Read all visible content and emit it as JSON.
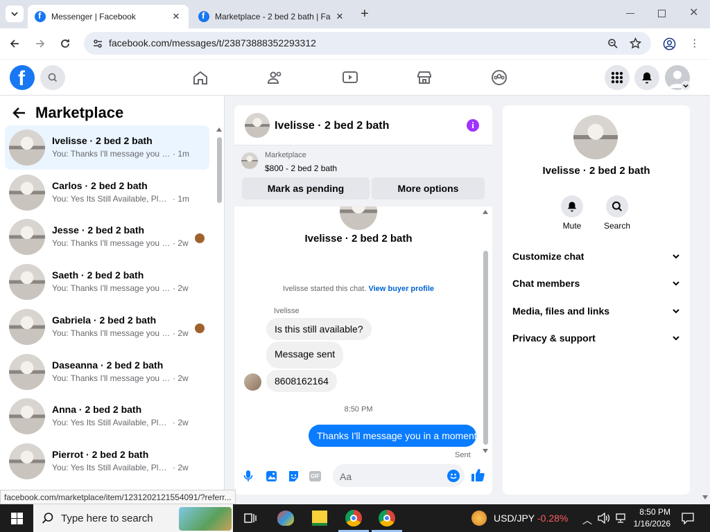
{
  "browser": {
    "tabs": [
      {
        "title": "Messenger | Facebook",
        "active": true
      },
      {
        "title": "Marketplace - 2 bed 2 bath | Fa",
        "active": false
      }
    ],
    "url": "facebook.com/messages/t/23873888352293312",
    "status_url": "facebook.com/marketplace/item/1231202121554091/?referr..."
  },
  "sidebar": {
    "title": "Marketplace",
    "conversations": [
      {
        "name": "Ivelisse · 2 bed 2 bath",
        "preview": "You: Thanks I'll message you in a ...",
        "time": "· 1m",
        "selected": true,
        "seen": false
      },
      {
        "name": "Carlos · 2 bed 2 bath",
        "preview": "You: Yes Its Still Available, Please S...",
        "time": "· 1m",
        "selected": false,
        "seen": false
      },
      {
        "name": "Jesse · 2 bed 2 bath",
        "preview": "You: Thanks I'll message you in ...",
        "time": "· 2w",
        "selected": false,
        "seen": true
      },
      {
        "name": "Saeth · 2 bed 2 bath",
        "preview": "You: Thanks I'll message you in a ...",
        "time": "· 2w",
        "selected": false,
        "seen": false
      },
      {
        "name": "Gabriela · 2 bed 2 bath",
        "preview": "You: Thanks I'll message you in ...",
        "time": "· 2w",
        "selected": false,
        "seen": true
      },
      {
        "name": "Daseanna · 2 bed 2 bath",
        "preview": "You: Thanks I'll message you in a ...",
        "time": "· 2w",
        "selected": false,
        "seen": false
      },
      {
        "name": "Anna · 2 bed 2 bath",
        "preview": "You: Yes Its Still Available, Please S...",
        "time": "· 2w",
        "selected": false,
        "seen": false
      },
      {
        "name": "Pierrot · 2 bed 2 bath",
        "preview": "You: Yes Its Still Available, Please S...",
        "time": "· 2w",
        "selected": false,
        "seen": false
      }
    ]
  },
  "chat": {
    "header_title": "Ivelisse · 2 bed 2 bath",
    "listing": {
      "source": "Marketplace",
      "price_title": "$800 - 2 bed 2 bath"
    },
    "mark_pending_label": "Mark as pending",
    "more_options_label": "More options",
    "intro_name": "Ivelisse · 2 bed 2 bath",
    "started_text": "Ivelisse started this chat.",
    "view_profile_link": "View buyer profile",
    "sender_name": "Ivelisse",
    "messages": [
      {
        "text": "Is this still available?",
        "mine": false
      },
      {
        "text": "Message sent",
        "mine": false,
        "bold": true
      },
      {
        "text": "8608162164",
        "mine": false
      },
      {
        "text": "Thanks I'll message you in a moment",
        "mine": true
      }
    ],
    "timestamp": "8:50 PM",
    "sent_status": "Sent",
    "composer_placeholder": "Aa"
  },
  "details": {
    "name": "Ivelisse · 2 bed 2 bath",
    "mute_label": "Mute",
    "search_label": "Search",
    "sections": [
      "Customize chat",
      "Chat members",
      "Media, files and links",
      "Privacy & support"
    ]
  },
  "taskbar": {
    "search_placeholder": "Type here to search",
    "ticker_name": "USD/JPY",
    "ticker_change": "-0.28%",
    "time": "8:50 PM",
    "date": "1/16/2026"
  },
  "colors": {
    "brand": "#1877f2",
    "accent": "#0a7cff",
    "info_icon": "#a033ff",
    "ticker_down": "#ff5d5d"
  }
}
